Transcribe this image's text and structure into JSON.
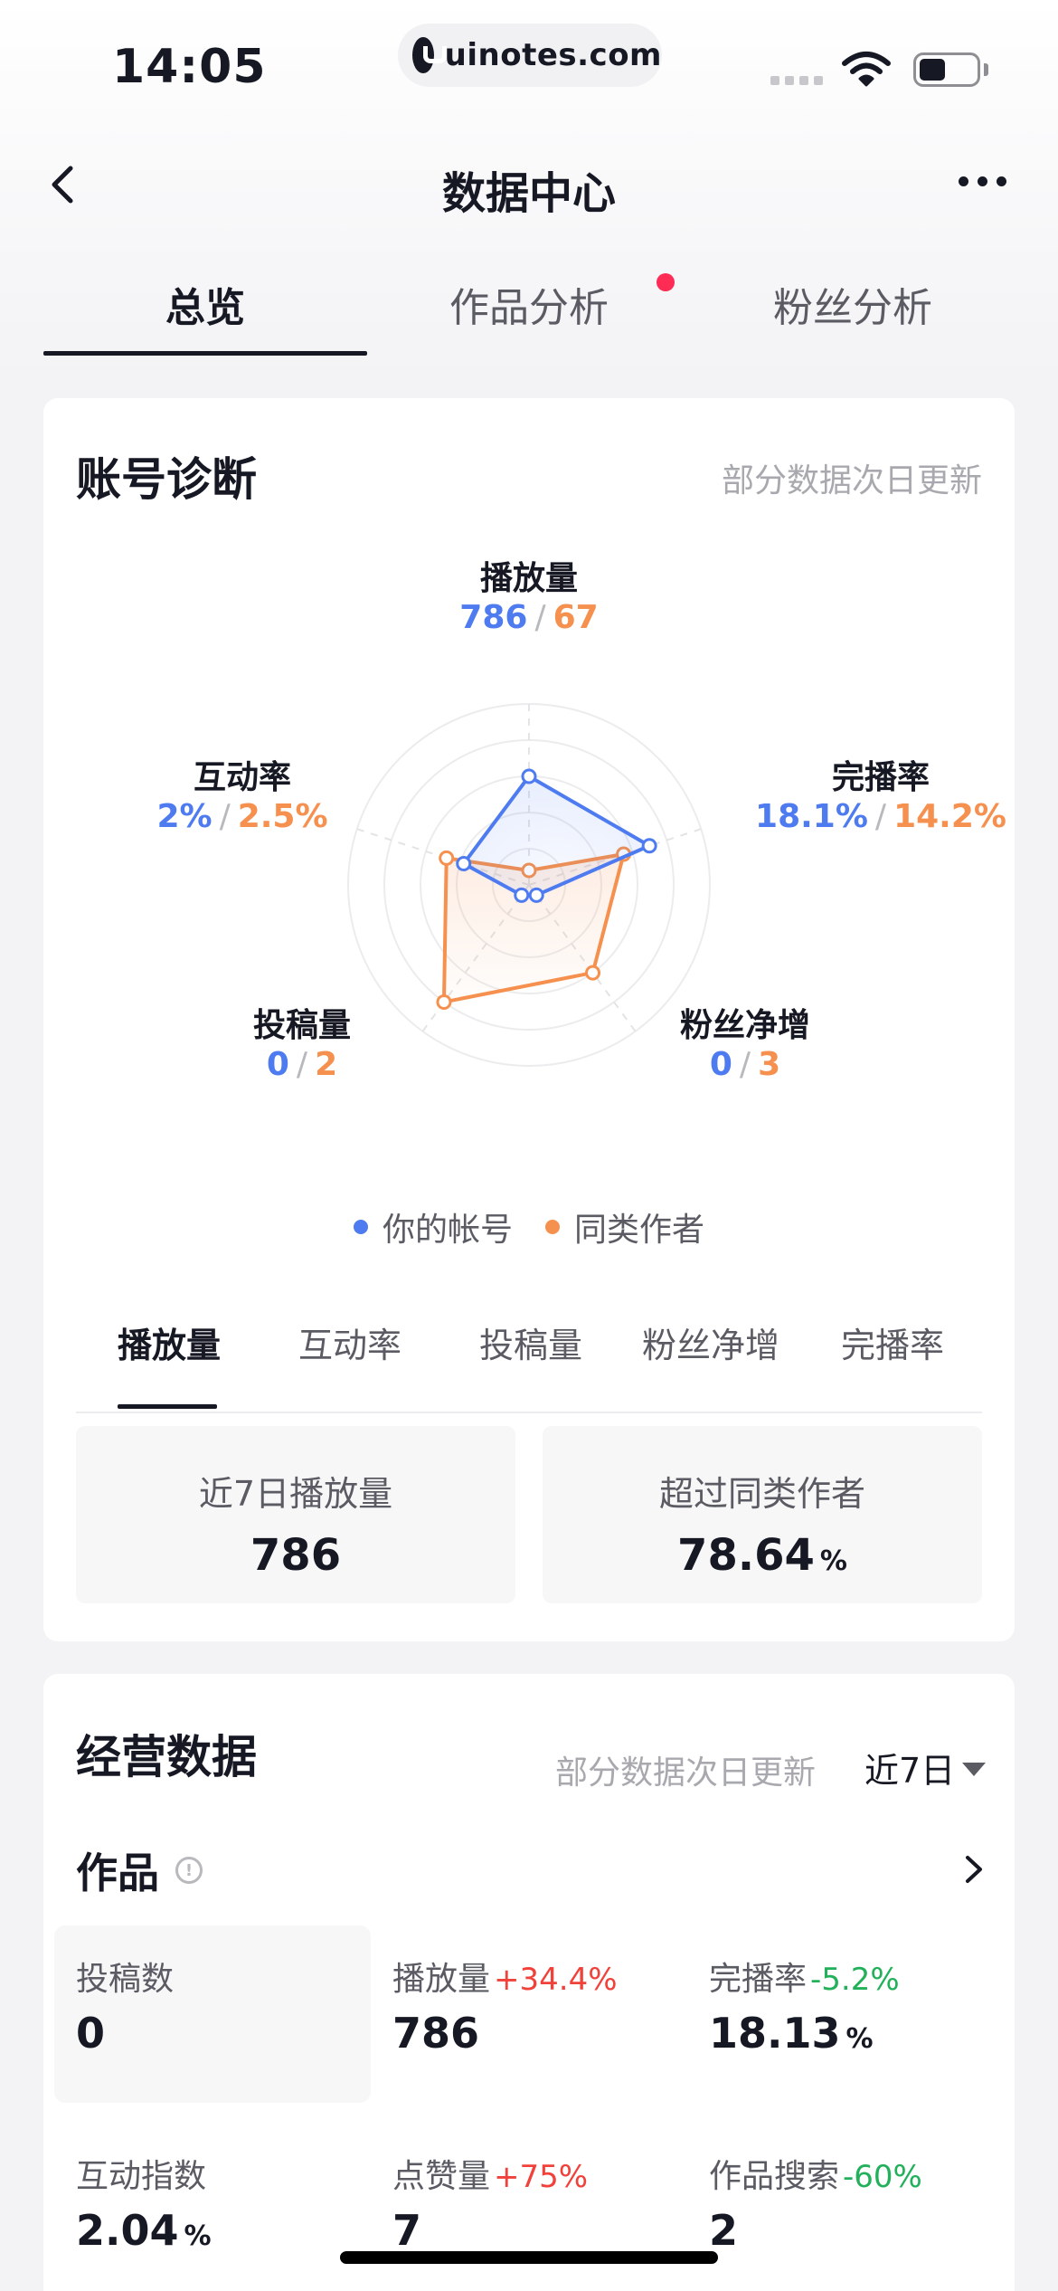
{
  "status_bar": {
    "time": "14:05",
    "url": "uinotes.com"
  },
  "nav": {
    "title": "数据中心"
  },
  "tabs": [
    {
      "label": "总览",
      "active": true
    },
    {
      "label": "作品分析",
      "active": false,
      "badge": true
    },
    {
      "label": "粉丝分析",
      "active": false
    }
  ],
  "diagnosis": {
    "title": "账号诊断",
    "note": "部分数据次日更新",
    "radar": {
      "axes": [
        {
          "label": "播放量",
          "you": "786",
          "peer": "67",
          "you_level": 0.6,
          "peer_level": 0.08
        },
        {
          "label": "完播率",
          "you": "18.1%",
          "peer": "14.2%",
          "you_level": 0.7,
          "peer_level": 0.55
        },
        {
          "label": "粉丝净增",
          "you": "0",
          "peer": "3",
          "you_level": 0.0,
          "peer_level": 0.6
        },
        {
          "label": "投稿量",
          "you": "0",
          "peer": "2",
          "you_level": 0.0,
          "peer_level": 0.8
        },
        {
          "label": "互动率",
          "you": "2%",
          "peer": "2.5%",
          "you_level": 0.38,
          "peer_level": 0.48
        }
      ],
      "colors": {
        "you": "#4e7bf0",
        "peer": "#f5904e"
      }
    },
    "legend": {
      "you": "你的帐号",
      "peer": "同类作者"
    },
    "subtabs": [
      {
        "label": "播放量",
        "active": true
      },
      {
        "label": "互动率",
        "active": false
      },
      {
        "label": "投稿量",
        "active": false
      },
      {
        "label": "粉丝净增",
        "active": false
      },
      {
        "label": "完播率",
        "active": false
      }
    ],
    "stats": [
      {
        "label": "近7日播放量",
        "value": "786",
        "unit": ""
      },
      {
        "label": "超过同类作者",
        "value": "78.64",
        "unit": "%"
      }
    ]
  },
  "business": {
    "title": "经营数据",
    "note": "部分数据次日更新",
    "range": "近7日",
    "works_title": "作品",
    "metrics": [
      {
        "label": "投稿数",
        "change": "",
        "trend": "",
        "value": "0",
        "unit": ""
      },
      {
        "label": "播放量",
        "change": "+34.4%",
        "trend": "up",
        "value": "786",
        "unit": ""
      },
      {
        "label": "完播率",
        "change": "-5.2%",
        "trend": "down",
        "value": "18.13",
        "unit": "%"
      },
      {
        "label": "互动指数",
        "change": "",
        "trend": "",
        "value": "2.04",
        "unit": "%"
      },
      {
        "label": "点赞量",
        "change": "+75%",
        "trend": "up",
        "value": "7",
        "unit": ""
      },
      {
        "label": "作品搜索",
        "change": "-60%",
        "trend": "down",
        "value": "2",
        "unit": ""
      }
    ]
  }
}
